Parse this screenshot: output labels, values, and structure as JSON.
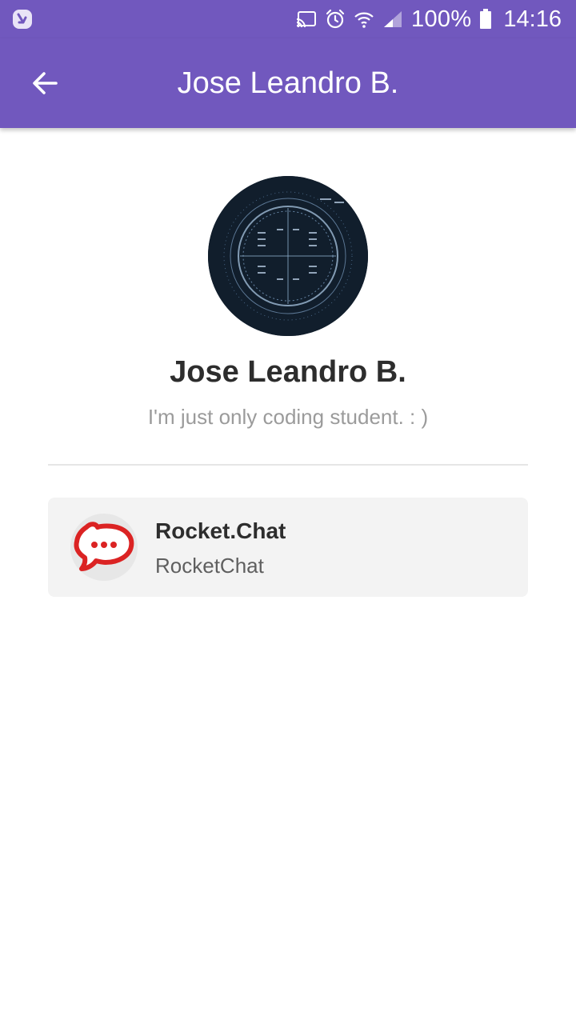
{
  "status_bar": {
    "battery": "100%",
    "time": "14:16",
    "icons": [
      "app-notification-icon",
      "cast-icon",
      "alarm-icon",
      "wifi-icon",
      "signal-icon",
      "battery-icon"
    ]
  },
  "app_bar": {
    "title": "Jose Leandro B.",
    "back_icon": "arrow-left-icon",
    "background": "#7158be"
  },
  "profile": {
    "name": "Jose Leandro B.",
    "status": "I'm just only coding student. : )"
  },
  "channel": {
    "title": "Rocket.Chat",
    "subtitle": "RocketChat",
    "logo_icon": "rocketchat-logo-icon",
    "logo_color": "#db2323"
  }
}
